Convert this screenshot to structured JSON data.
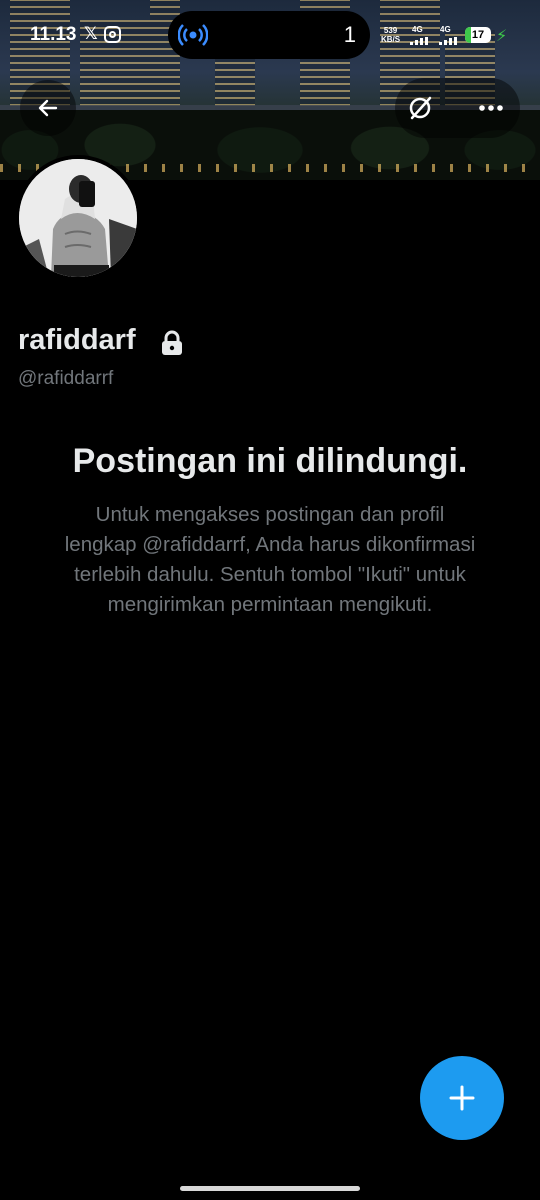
{
  "status_bar": {
    "time": "11.13",
    "notification_icons": [
      "x-logo-icon",
      "instagram-icon"
    ],
    "pill_count": "1",
    "net_speed_value": "539",
    "net_speed_unit": "KB/S",
    "network_1": "4G",
    "network_2": "4G",
    "battery": "17"
  },
  "header": {
    "back_icon": "arrow-left-icon",
    "grok_icon": "grok-icon",
    "more_icon": "more-horizontal-icon"
  },
  "profile": {
    "display_name": "rafiddarf",
    "handle": "@rafiddarrf",
    "protected_icon": "lock-icon"
  },
  "protected_notice": {
    "title": "Postingan ini dilindungi.",
    "body": "Untuk mengakses postingan dan profil lengkap @rafiddarrf, Anda harus dikonfirmasi terlebih dahulu. Sentuh tombol \"Ikuti\" untuk mengirimkan permintaan mengikuti."
  },
  "fab": {
    "icon": "plus-icon"
  },
  "colors": {
    "accent": "#1d9bf0",
    "background": "#000000",
    "text_primary": "#e7e9ea",
    "text_secondary": "#71767b"
  }
}
